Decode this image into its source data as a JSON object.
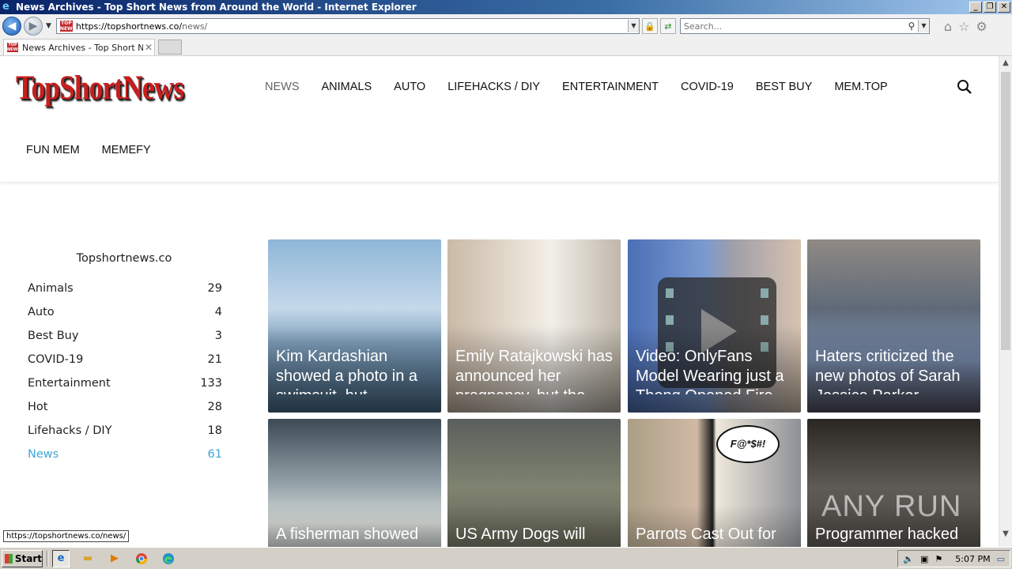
{
  "window": {
    "title": "News Archives - Top Short News from Around the World - Internet Explorer",
    "min_label": "_",
    "max_label": "❐",
    "close_label": "✕"
  },
  "browser": {
    "url_host": "https://topshortnews.co/",
    "url_path": "news/",
    "search_placeholder": "Search...",
    "tab_title": "News Archives - Top Short N...",
    "tab_close": "✕",
    "favicon_text": "TOP NEWS"
  },
  "site": {
    "logo": "TopShortNews",
    "nav": [
      {
        "label": "NEWS",
        "active": true
      },
      {
        "label": "ANIMALS"
      },
      {
        "label": "AUTO"
      },
      {
        "label": "LIFEHACKS / DIY"
      },
      {
        "label": "ENTERTAINMENT"
      },
      {
        "label": "COVID-19"
      },
      {
        "label": "BEST BUY"
      },
      {
        "label": "MEM.TOP"
      }
    ],
    "nav2": [
      {
        "label": "FUN MEM"
      },
      {
        "label": "MEMEFY"
      }
    ]
  },
  "sidebar": {
    "title": "Topshortnews.co",
    "categories": [
      {
        "name": "Animals",
        "count": "29"
      },
      {
        "name": "Auto",
        "count": "4"
      },
      {
        "name": "Best Buy",
        "count": "3"
      },
      {
        "name": "COVID-19",
        "count": "21"
      },
      {
        "name": "Entertainment",
        "count": "133"
      },
      {
        "name": "Hot",
        "count": "28"
      },
      {
        "name": "Lifehacks / DIY",
        "count": "18"
      },
      {
        "name": "News",
        "count": "61",
        "active": true
      }
    ]
  },
  "articles": [
    {
      "title": "Kim Kardashian showed a photo in a swimsuit, but"
    },
    {
      "title": "Emily Ratajkowski has announced her pregnancy, but the"
    },
    {
      "title": "Video: OnlyFans Model Wearing just a Thong Opened Fire"
    },
    {
      "title": "Haters criticized the new photos of Sarah Jessica Parker"
    },
    {
      "title": "A fisherman showed"
    },
    {
      "title": "US Army Dogs will"
    },
    {
      "title": "Parrots Cast Out for",
      "bubble": "F@*$#!"
    },
    {
      "title": "Programmer hacked",
      "watermark": "ANY RUN"
    }
  ],
  "status": {
    "hover_url": "https://topshortnews.co/news/"
  },
  "taskbar": {
    "start_label": "Start",
    "clock": "5:07 PM"
  },
  "colors": {
    "logo_red": "#c81e1e",
    "active_link": "#3ea6d8"
  }
}
